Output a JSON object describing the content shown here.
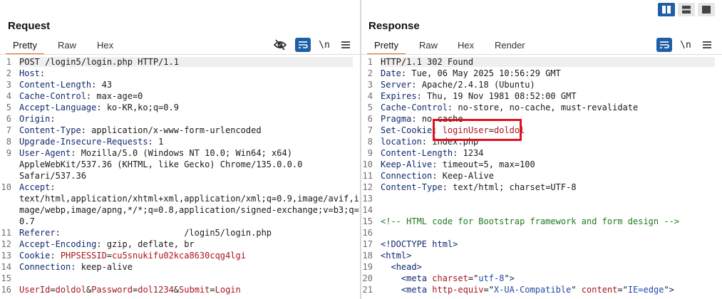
{
  "layout_buttons": [
    {
      "icon": "split-columns-icon",
      "active": true
    },
    {
      "icon": "split-rows-icon",
      "active": false
    },
    {
      "icon": "single-pane-icon",
      "active": false
    }
  ],
  "request": {
    "title": "Request",
    "tabs": [
      "Pretty",
      "Raw",
      "Hex"
    ],
    "active_tab": "Pretty",
    "tools": [
      {
        "icon": "eye-off-icon"
      },
      {
        "icon": "wrap-lines-icon",
        "active": true
      },
      {
        "label": "\\n",
        "icon": "newline-toggle-icon"
      },
      {
        "icon": "menu-icon"
      }
    ],
    "lines": [
      {
        "n": "1",
        "start_line": "POST /login5/login.php HTTP/1.1"
      },
      {
        "n": "2",
        "name": "Host",
        "value": ""
      },
      {
        "n": "3",
        "name": "Content-Length",
        "value": "43"
      },
      {
        "n": "4",
        "name": "Cache-Control",
        "value": "max-age=0"
      },
      {
        "n": "5",
        "name": "Accept-Language",
        "value": "ko-KR,ko;q=0.9"
      },
      {
        "n": "6",
        "name": "Origin",
        "value": ""
      },
      {
        "n": "7",
        "name": "Content-Type",
        "value": "application/x-www-form-urlencoded"
      },
      {
        "n": "8",
        "name": "Upgrade-Insecure-Requests",
        "value": "1"
      },
      {
        "n": "9",
        "name": "User-Agent",
        "value": "Mozilla/5.0 (Windows NT 10.0; Win64; x64)"
      },
      {
        "n": "",
        "cont": "AppleWebKit/537.36 (KHTML, like Gecko) Chrome/135.0.0.0"
      },
      {
        "n": "",
        "cont": "Safari/537.36"
      },
      {
        "n": "10",
        "name": "Accept",
        "value": ""
      },
      {
        "n": "",
        "cont": "text/html,application/xhtml+xml,application/xml;q=0.9,image/avif,i"
      },
      {
        "n": "",
        "cont": "mage/webp,image/apng,*/*;q=0.8,application/signed-exchange;v=b3;q="
      },
      {
        "n": "",
        "cont": "0.7"
      },
      {
        "n": "11",
        "name": "Referer",
        "value": "                       /login5/login.php"
      },
      {
        "n": "12",
        "name": "Accept-Encoding",
        "value": "gzip, deflate, br"
      },
      {
        "n": "13",
        "name": "Cookie",
        "cookie_name": "PHPSESSID",
        "cookie_value": "cu5snukifu02kca8630cqg4lgi"
      },
      {
        "n": "14",
        "name": "Connection",
        "value": "keep-alive"
      },
      {
        "n": "15",
        "blank": true
      },
      {
        "n": "16",
        "params": [
          {
            "k": "UserId",
            "v": "doldol"
          },
          {
            "k": "Password",
            "v": "dol1234"
          },
          {
            "k": "Submit",
            "v": "Login"
          }
        ]
      }
    ]
  },
  "response": {
    "title": "Response",
    "tabs": [
      "Pretty",
      "Raw",
      "Hex",
      "Render"
    ],
    "active_tab": "Pretty",
    "tools": [
      {
        "icon": "wrap-lines-icon",
        "active": true
      },
      {
        "label": "\\n",
        "icon": "newline-toggle-icon"
      },
      {
        "icon": "menu-icon"
      }
    ],
    "lines": [
      {
        "n": "1",
        "start_line": "HTTP/1.1 302 Found"
      },
      {
        "n": "2",
        "name": "Date",
        "value": "Tue, 06 May 2025 10:56:29 GMT"
      },
      {
        "n": "3",
        "name": "Server",
        "value": "Apache/2.4.18 (Ubuntu)"
      },
      {
        "n": "4",
        "name": "Expires",
        "value": "Thu, 19 Nov 1981 08:52:00 GMT"
      },
      {
        "n": "5",
        "name": "Cache-Control",
        "value": "no-store, no-cache, must-revalidate"
      },
      {
        "n": "6",
        "name": "Pragma",
        "value": "no-cache"
      },
      {
        "n": "7",
        "name": "Set-Cookie",
        "cookie_name": "loginUser",
        "cookie_value": "doldol"
      },
      {
        "n": "8",
        "name": "location",
        "value": "index.php"
      },
      {
        "n": "9",
        "name": "Content-Length",
        "value": "1234"
      },
      {
        "n": "10",
        "name": "Keep-Alive",
        "value": "timeout=5, max=100"
      },
      {
        "n": "11",
        "name": "Connection",
        "value": "Keep-Alive"
      },
      {
        "n": "12",
        "name": "Content-Type",
        "value": "text/html; charset=UTF-8"
      },
      {
        "n": "13",
        "blank": true
      },
      {
        "n": "14",
        "blank": true
      },
      {
        "n": "15",
        "comment": "<!-- HTML code for Bootstrap framework and form design -->"
      },
      {
        "n": "16",
        "blank": true
      },
      {
        "n": "17",
        "doctype": "<!DOCTYPE html>"
      },
      {
        "n": "18",
        "indent": 0,
        "tag": "html",
        "attrs": []
      },
      {
        "n": "19",
        "indent": 1,
        "tag": "head",
        "attrs": []
      },
      {
        "n": "20",
        "indent": 2,
        "tag": "meta",
        "attrs": [
          {
            "k": "charset",
            "v": "utf-8"
          }
        ]
      },
      {
        "n": "21",
        "indent": 2,
        "tag": "meta",
        "attrs": [
          {
            "k": "http-equiv",
            "v": "X-UA-Compatible"
          },
          {
            "k": "content",
            "v": "IE=edge"
          }
        ]
      }
    ]
  }
}
